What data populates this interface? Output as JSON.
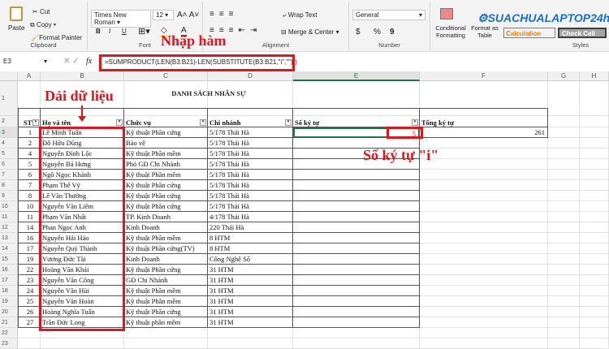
{
  "ribbon": {
    "clipboard": {
      "paste": "Paste",
      "cut": "Cut",
      "copy": "Copy",
      "format_painter": "Format Painter",
      "label": "Clipboard"
    },
    "font": {
      "name": "Times New Roman",
      "size": "12",
      "bold": "B",
      "italic": "I",
      "underline": "U",
      "label": "Font"
    },
    "alignment": {
      "wrap": "Wrap Text",
      "merge": "Merge & Center",
      "label": "Alignment"
    },
    "number": {
      "format": "General",
      "currency": "$",
      "percent": "%",
      "comma": "9",
      "label": "Number"
    },
    "styles": {
      "conditional": "Conditional Formatting",
      "format_table": "Format as Table",
      "calculation": "Calculation",
      "check_cell": "Check Cell",
      "label": "Styles"
    },
    "logo": "SUACHUALAPTOP24h.com"
  },
  "formula_bar": {
    "name_box": "E3",
    "fx": "fx",
    "formula": "=SUMPRODUCT(LEN(B3:B21)-LEN(SUBSTITUTE(B3:B21,\"i\",\"\")))"
  },
  "columns": [
    "A",
    "B",
    "C",
    "D",
    "E",
    "F",
    "G",
    "H"
  ],
  "rows": [
    "1",
    "2",
    "3",
    "4",
    "5",
    "6",
    "7",
    "8",
    "9",
    "10",
    "11",
    "12",
    "13",
    "14",
    "15",
    "16",
    "17",
    "18",
    "19",
    "20",
    "21",
    "22",
    "23"
  ],
  "sheet": {
    "title": "DANH SÁCH NHÂN SỰ",
    "headers": [
      "STT",
      "Họ và tên",
      "Chức vụ",
      "Chi nhánh",
      "Số ký tự",
      "Tổng ký tự"
    ],
    "data": [
      [
        "1",
        "Lê Minh Tuấn",
        "Kỹ thuật Phần cứng",
        "5/178 Thái Hà"
      ],
      [
        "2",
        "Đỗ Hữu Dũng",
        "Bảo vệ",
        "5/178 Thái Hà"
      ],
      [
        "4",
        "Nguyễn Đình Lộc",
        "Kỹ thuật Phần mềm",
        "5/178 Thái Hà"
      ],
      [
        "5",
        "Nguyễn Bá Hưng",
        "Phó GĐ Chi Nhánh",
        "5/178 Thái Hà"
      ],
      [
        "6",
        "Ngô Ngọc Khánh",
        "Kỹ thuật Phần mềm",
        "5/178 Thái Hà"
      ],
      [
        "7",
        "Phạm Thế Vỹ",
        "Kỹ thuật Phần cứng",
        "5/178 Thái Hà"
      ],
      [
        "8",
        "Lê Văn Thường",
        "Kỹ thuật Phần cứng",
        "5/178 Thái Hà"
      ],
      [
        "10",
        "Nguyễn Văn Liêm",
        "Kỹ thuật Phần cứng",
        "5/178 Thái Hà"
      ],
      [
        "11",
        "Phạm Văn Nhất",
        "TP. Kinh Doanh",
        "4/178 Thái Hà"
      ],
      [
        "14",
        "Phan Ngọc Anh",
        "Kinh Doanh",
        "220 Thái Hà"
      ],
      [
        "16",
        "Nguyễn Hải Hào",
        "Kỹ thuật Phần mềm",
        "8 HTM"
      ],
      [
        "17",
        "Nguyễn Quý Thành",
        "Kỹ thuật Phần cứng(TV)",
        "8 HTM"
      ],
      [
        "19",
        "Vương Đức Tài",
        "Kinh Doanh",
        "Công Nghệ Số"
      ],
      [
        "22",
        " Hoàng Văn Khải",
        "Kỹ thuật Phần cứng",
        "31 HTM"
      ],
      [
        "23",
        " Nguyễn Văn Công",
        "GĐ Chi Nhánh",
        "31 HTM"
      ],
      [
        "24",
        " Nguyễn Văn Hùi",
        "Kỹ thuật Phần mềm",
        "31 HTM"
      ],
      [
        "25",
        " Nguyễn Văn Hoàn",
        "Kỹ thuật Phần mềm",
        "31 HTM"
      ],
      [
        "26",
        " Hoàng Nghĩa Tuấn",
        "Kỹ thuật Phần cứng",
        "31 HTM"
      ],
      [
        "27",
        " Trần Đức Long",
        "Kỹ thuật phần mềm",
        "31 HTM"
      ]
    ],
    "e3_value": "5",
    "f3_value": "261"
  },
  "annotations": {
    "formula": "Nhập hàm",
    "range": "Dải dữ liệu",
    "result": "Số ký tự \"i\""
  },
  "colors": {
    "accent": "#e3141b",
    "selected": "#217346"
  }
}
